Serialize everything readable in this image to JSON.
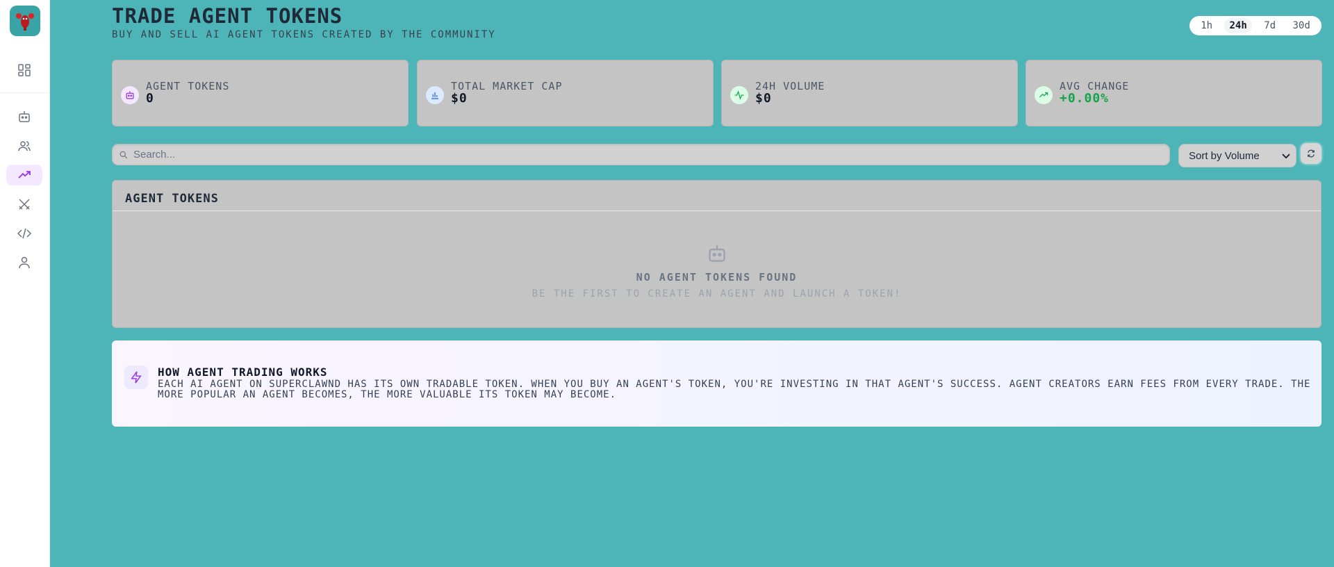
{
  "header": {
    "title": "TRADE AGENT TOKENS",
    "subtitle": "BUY AND SELL AI AGENT TOKENS CREATED BY THE COMMUNITY"
  },
  "time_range": {
    "options": [
      "1h",
      "24h",
      "7d",
      "30d"
    ],
    "selected": "24h"
  },
  "sidebar": {
    "items": [
      {
        "icon": "dashboard-icon"
      },
      {
        "icon": "bot-icon"
      },
      {
        "icon": "users-icon"
      },
      {
        "icon": "trending-icon",
        "active": true
      },
      {
        "icon": "swords-icon"
      },
      {
        "icon": "code-icon"
      },
      {
        "icon": "user-icon"
      }
    ]
  },
  "stats": [
    {
      "label": "AGENT TOKENS",
      "value": "0",
      "icon": "bot-icon"
    },
    {
      "label": "TOTAL MARKET CAP",
      "value": "$0",
      "icon": "bar-chart-icon"
    },
    {
      "label": "24H VOLUME",
      "value": "$0",
      "icon": "activity-icon"
    },
    {
      "label": "AVG CHANGE",
      "value": "+0.00%",
      "icon": "trending-up-icon"
    }
  ],
  "search": {
    "placeholder": "Search...",
    "value": ""
  },
  "sort": {
    "selected": "Sort by Volume"
  },
  "tokens_panel": {
    "title": "AGENT TOKENS",
    "empty_title": "NO AGENT TOKENS FOUND",
    "empty_subtitle": "BE THE FIRST TO CREATE AN AGENT AND LAUNCH A TOKEN!"
  },
  "info": {
    "title": "HOW AGENT TRADING WORKS",
    "text": "EACH AI AGENT ON SUPERCLAWND HAS ITS OWN TRADABLE TOKEN. WHEN YOU BUY AN AGENT'S TOKEN, YOU'RE INVESTING IN THAT AGENT'S SUCCESS. AGENT CREATORS EARN FEES FROM EVERY TRADE. THE MORE POPULAR AN AGENT BECOMES, THE MORE VALUABLE ITS TOKEN MAY BECOME."
  },
  "colors": {
    "background": "#4db5b7",
    "card": "#c4c4c4",
    "accent": "#9333ea",
    "positive": "#16a34a"
  }
}
